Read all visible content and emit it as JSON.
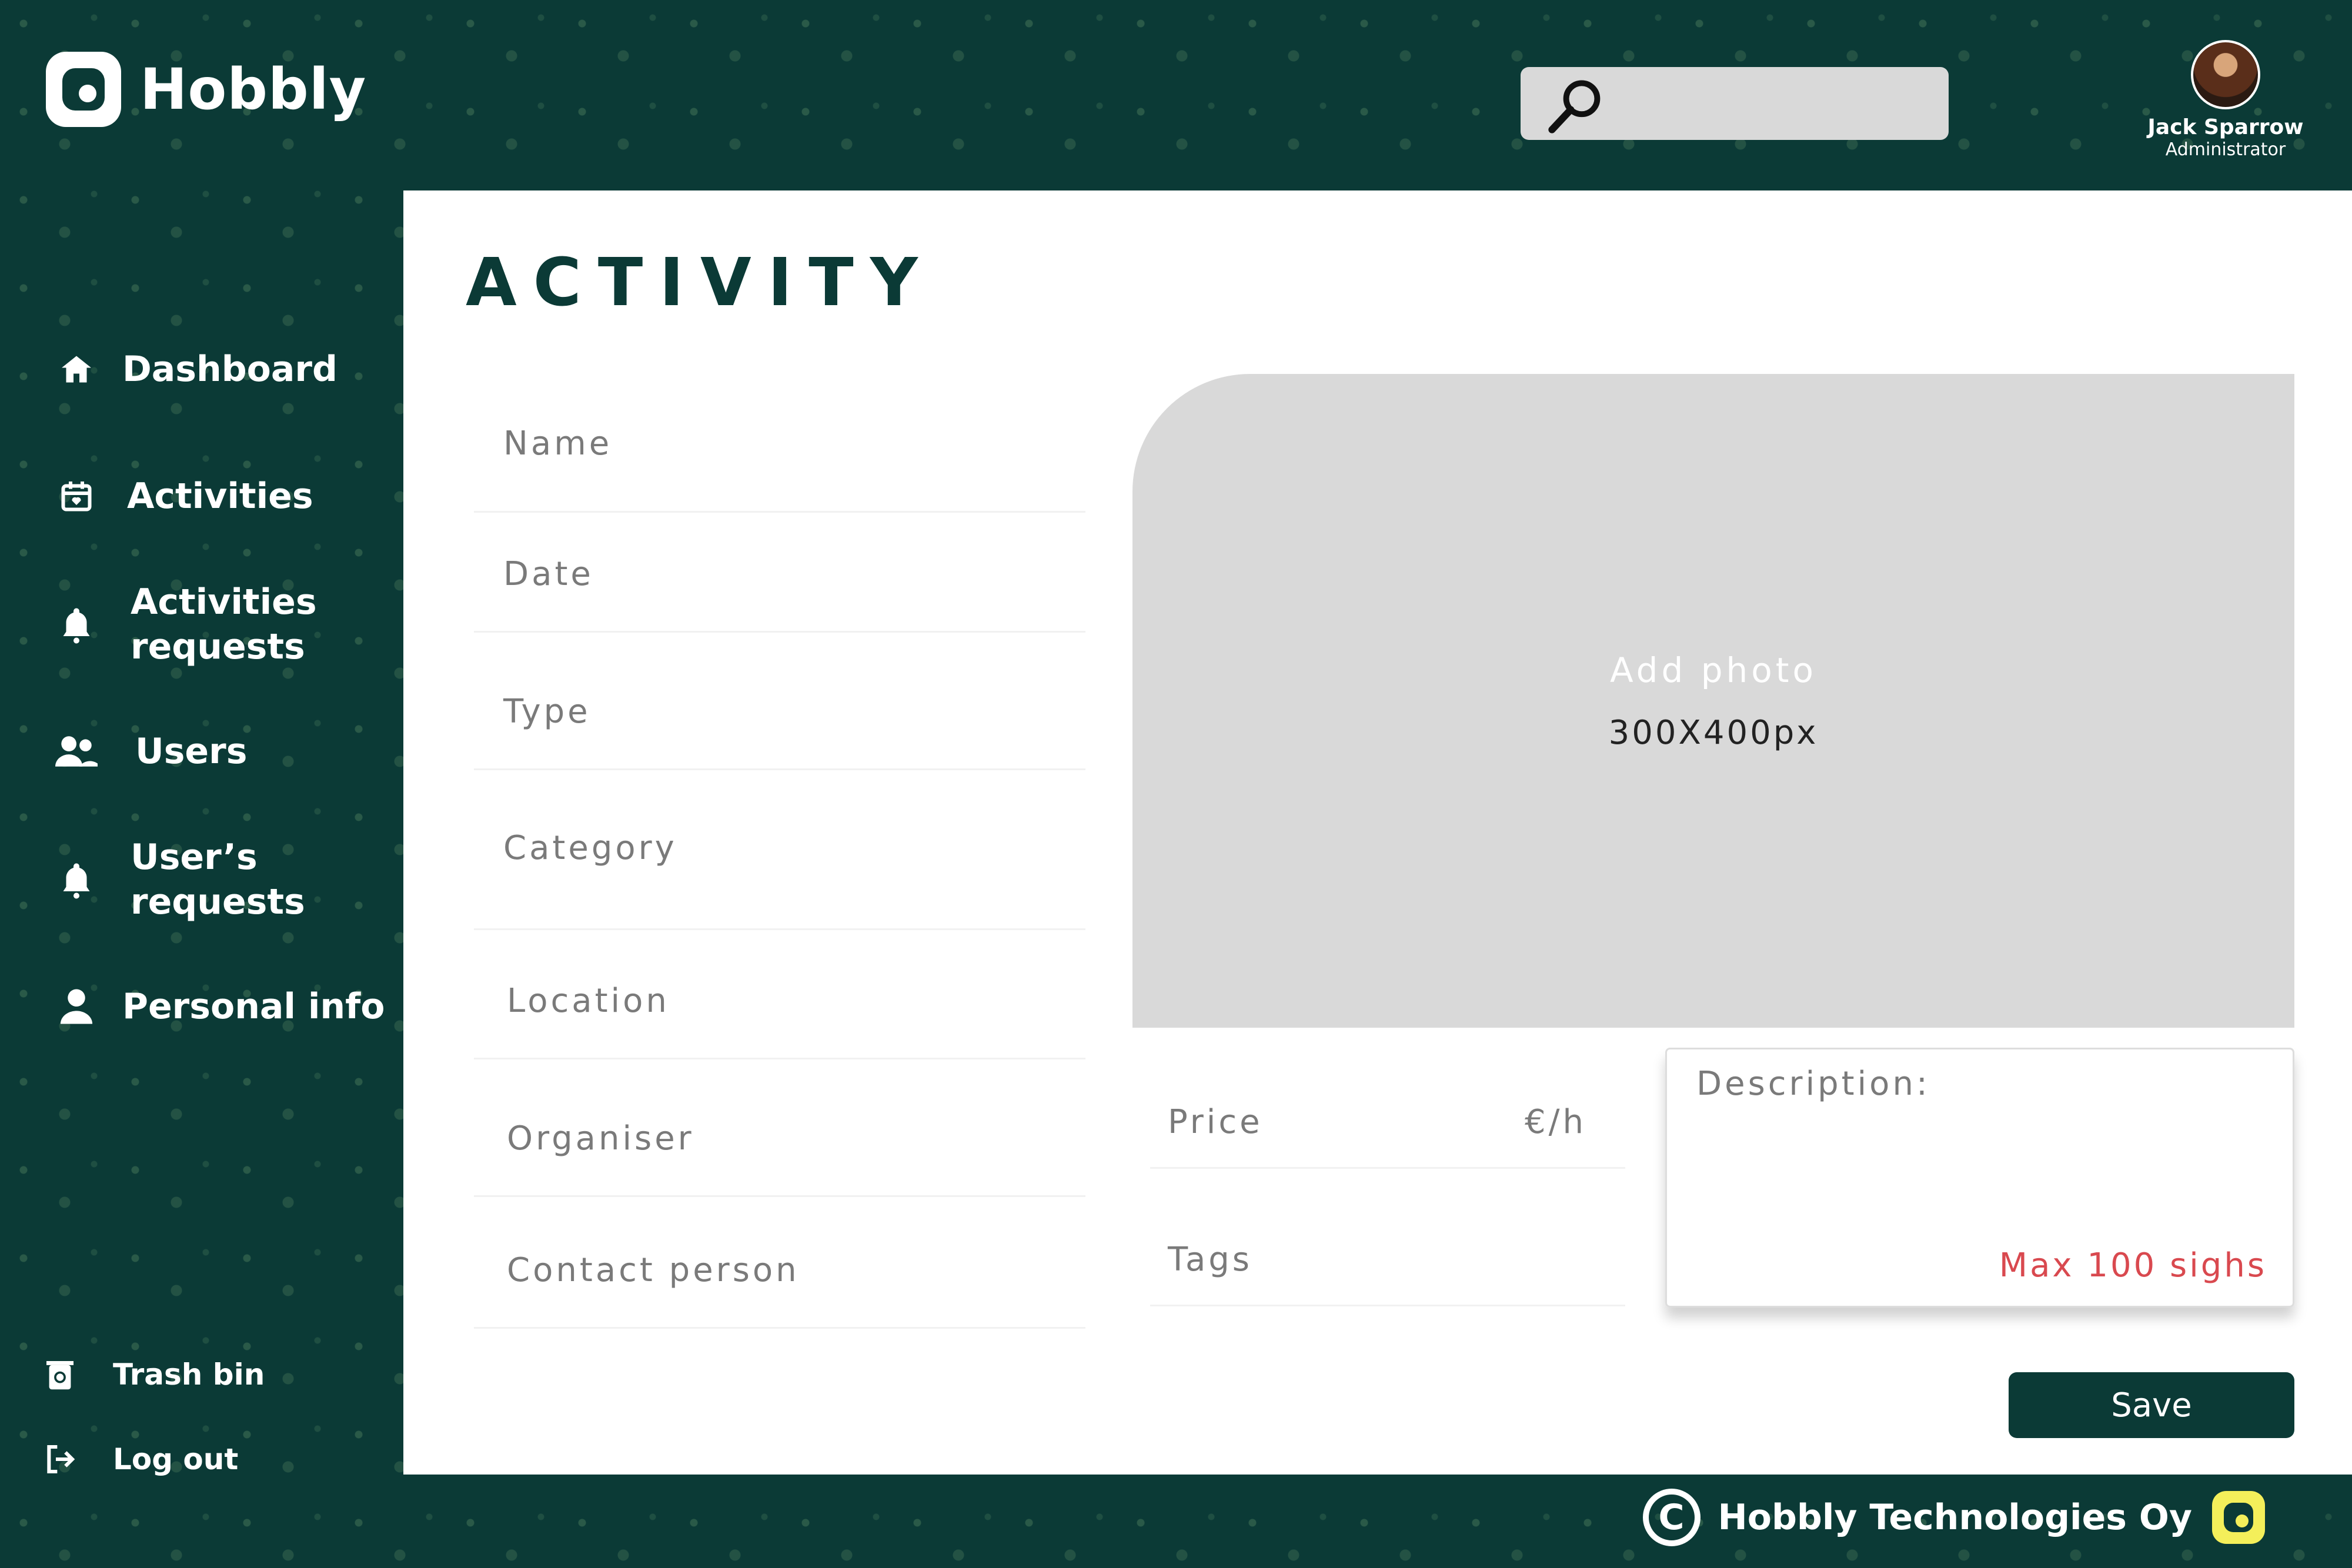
{
  "app": {
    "name": "Hobbly"
  },
  "header": {
    "search": {
      "placeholder": ""
    },
    "user": {
      "name": "Jack Sparrow",
      "role": "Administrator"
    }
  },
  "sidebar": {
    "items": [
      {
        "label": "Dashboard",
        "icon": "home-icon"
      },
      {
        "label": "Activities",
        "icon": "calendar-icon"
      },
      {
        "label": "Activities requests",
        "icon": "bell-icon"
      },
      {
        "label": "Users",
        "icon": "users-icon"
      },
      {
        "label": "User’s requests",
        "icon": "bell-icon"
      },
      {
        "label": "Personal info",
        "icon": "person-icon"
      }
    ],
    "bottom": [
      {
        "label": "Trash bin",
        "icon": "trash-icon"
      },
      {
        "label": "Log out",
        "icon": "logout-icon"
      }
    ]
  },
  "main": {
    "title": "ACTIVITY",
    "fields": {
      "name": "Name",
      "date": "Date",
      "type": "Type",
      "category": "Category",
      "location": "Location",
      "organiser": "Organiser",
      "contact": "Contact person"
    },
    "photo": {
      "title": "Add photo",
      "size": "300X400px"
    },
    "price": {
      "label": "Price",
      "unit": "€/h"
    },
    "tags": {
      "label": "Tags"
    },
    "description": {
      "label": "Description:",
      "limit": "Max 100 sighs"
    },
    "save_label": "Save"
  },
  "footer": {
    "company": "Hobbly Technologies Oy"
  },
  "colors": {
    "primary": "#0b3a36",
    "panel": "#ffffff",
    "placeholder": "#d9d9d9",
    "warning": "#d9494f",
    "accent": "#f4ef5a"
  }
}
